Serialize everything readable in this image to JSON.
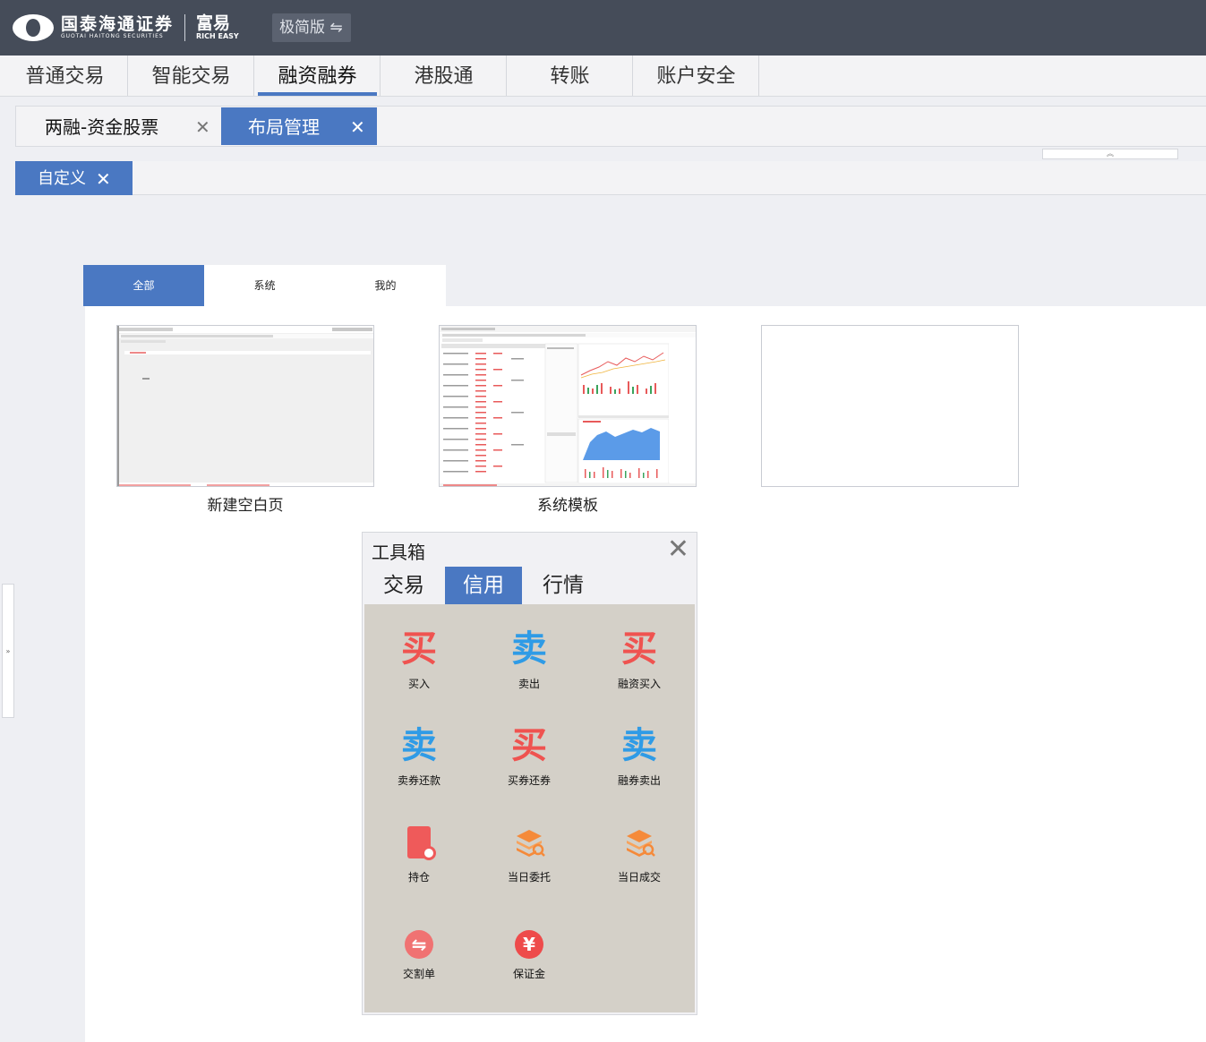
{
  "header": {
    "logo_cn": "国泰海通证券",
    "logo_en": "GUOTAI HAITONG SECURITIES",
    "brand_cn": "富易",
    "brand_en": "RICH EASY",
    "edition": "极简版 ⇋"
  },
  "mainnav": [
    "普通交易",
    "智能交易",
    "融资融券",
    "港股通",
    "转账",
    "账户安全"
  ],
  "subtabs": {
    "tab1": "两融-资金股票",
    "tab2": "布局管理",
    "close": "✕"
  },
  "third": {
    "custom": "自定义",
    "close": "✕"
  },
  "filters": [
    "全部",
    "系统",
    "我的"
  ],
  "templates": [
    {
      "label": "新建空白页"
    },
    {
      "label": "系统模板"
    }
  ],
  "toolbox": {
    "title": "工具箱",
    "close": "✕",
    "tabs": [
      "交易",
      "信用",
      "行情"
    ],
    "items": [
      {
        "glyph": "买",
        "label": "买入"
      },
      {
        "glyph": "卖",
        "label": "卖出"
      },
      {
        "glyph": "买",
        "label": "融资买入"
      },
      {
        "glyph": "卖",
        "label": "卖券还款"
      },
      {
        "glyph": "买",
        "label": "买券还券"
      },
      {
        "glyph": "卖",
        "label": "融券卖出"
      },
      {
        "glyph": "",
        "label": "持仓"
      },
      {
        "glyph": "",
        "label": "当日委托"
      },
      {
        "glyph": "",
        "label": "当日成交"
      },
      {
        "glyph": "⇋",
        "label": "交割单"
      },
      {
        "glyph": "¥",
        "label": "保证金"
      }
    ]
  },
  "colors": {
    "accent": "#4a78c2",
    "topbar": "#454c59",
    "buy": "#ef5350",
    "sell": "#2f9be6"
  }
}
